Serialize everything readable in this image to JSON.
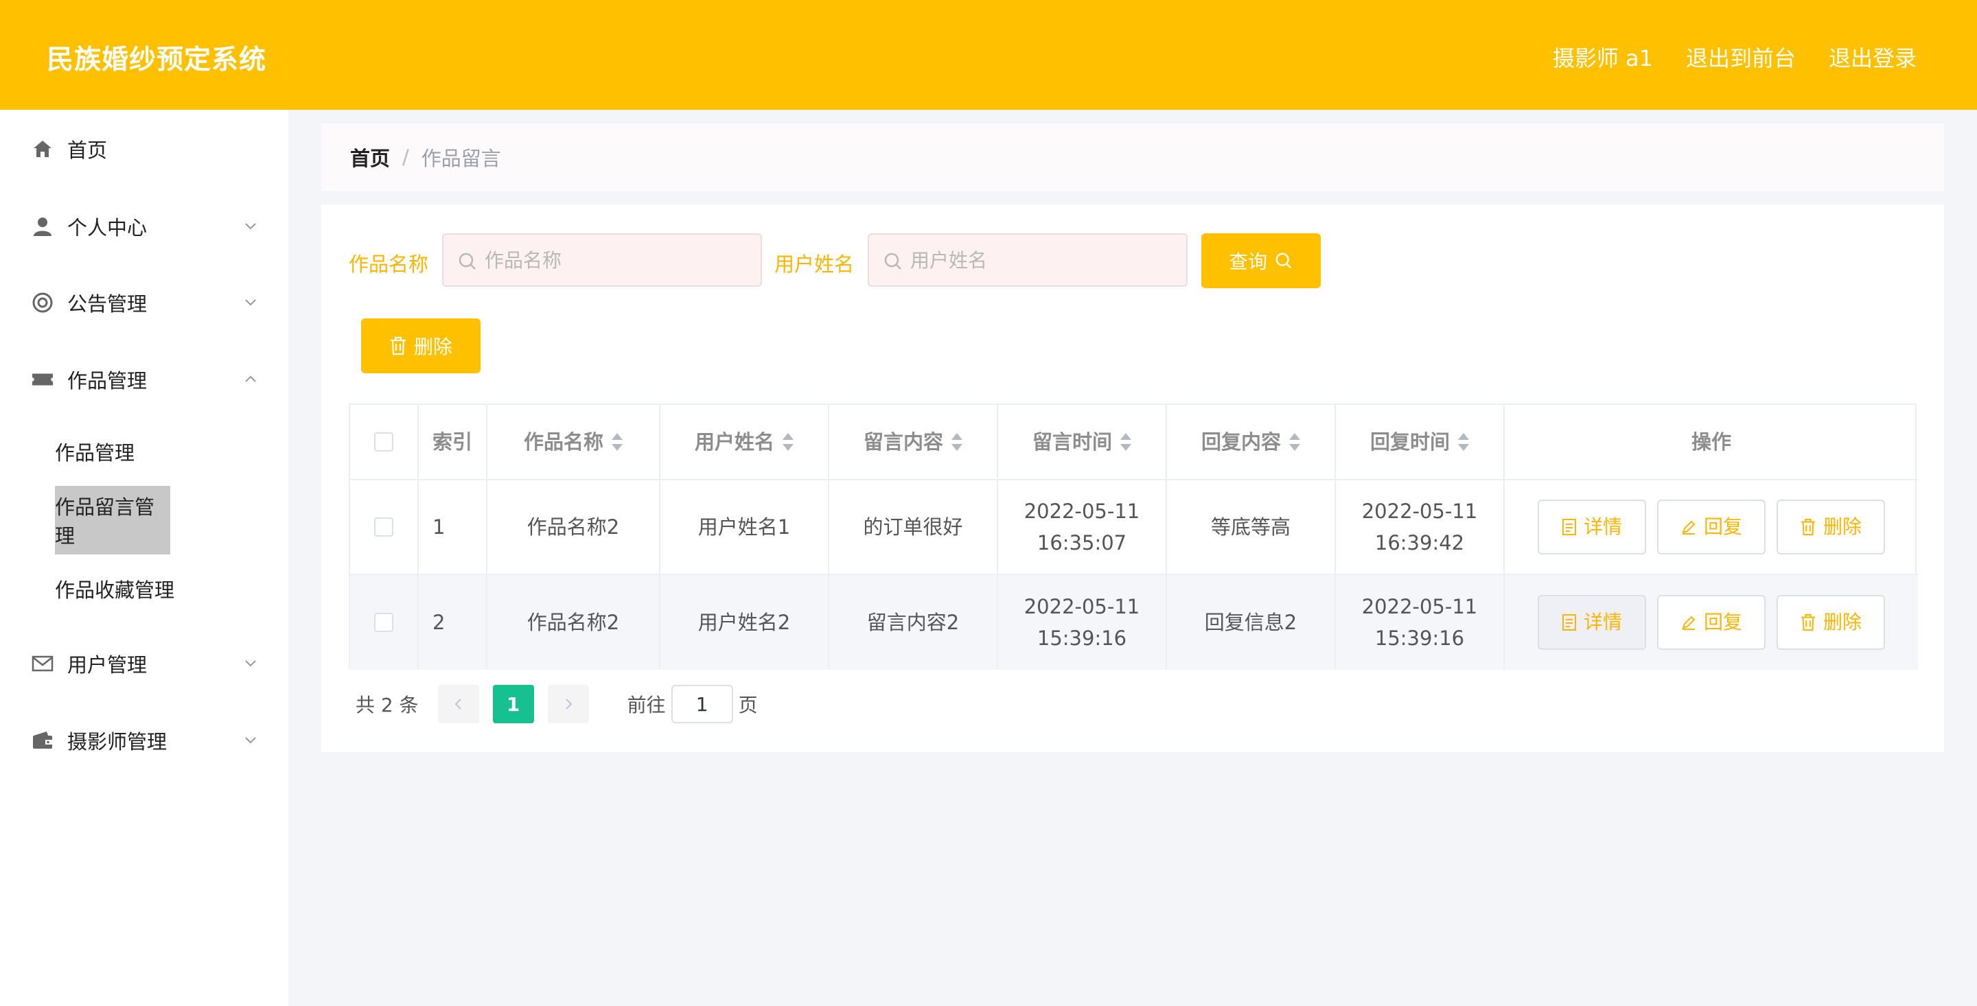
{
  "header": {
    "title": "民族婚纱预定系统",
    "user": "摄影师 a1",
    "to_front": "退出到前台",
    "logout": "退出登录"
  },
  "sidebar": {
    "items": [
      {
        "label": "首页",
        "icon": "home-icon"
      },
      {
        "label": "个人中心",
        "icon": "user-icon"
      },
      {
        "label": "公告管理",
        "icon": "lifebuoy-icon"
      },
      {
        "label": "作品管理",
        "icon": "ticket-icon"
      },
      {
        "label": "用户管理",
        "icon": "mail-icon"
      },
      {
        "label": "摄影师管理",
        "icon": "wallet-icon"
      }
    ],
    "submenu": [
      "作品管理",
      "作品留言管理",
      "作品收藏管理"
    ]
  },
  "breadcrumb": {
    "home": "首页",
    "separator": "/",
    "current": "作品留言"
  },
  "search": {
    "work_label": "作品名称",
    "work_placeholder": "作品名称",
    "user_label": "用户姓名",
    "user_placeholder": "用户姓名",
    "query_button": "查询"
  },
  "actions": {
    "delete_button": "删除"
  },
  "table": {
    "headers": [
      "索引",
      "作品名称",
      "用户姓名",
      "留言内容",
      "留言时间",
      "回复内容",
      "回复时间",
      "操作"
    ],
    "rows": [
      {
        "index": "1",
        "work": "作品名称2",
        "user": "用户姓名1",
        "content": "的订单很好",
        "time": "2022-05-11 16:35:07",
        "reply": "等底等高",
        "reply_time": "2022-05-11 16:39:42"
      },
      {
        "index": "2",
        "work": "作品名称2",
        "user": "用户姓名2",
        "content": "留言内容2",
        "time": "2022-05-11 15:39:16",
        "reply": "回复信息2",
        "reply_time": "2022-05-11 15:39:16"
      }
    ],
    "op_buttons": {
      "detail": "详情",
      "reply": "回复",
      "delete": "删除"
    }
  },
  "pager": {
    "total": "共 2 条",
    "current": "1",
    "goto": "前往",
    "page_value": "1",
    "page_suffix": "页"
  },
  "colors": {
    "accent": "#ffc000",
    "page_active": "#16c090"
  }
}
